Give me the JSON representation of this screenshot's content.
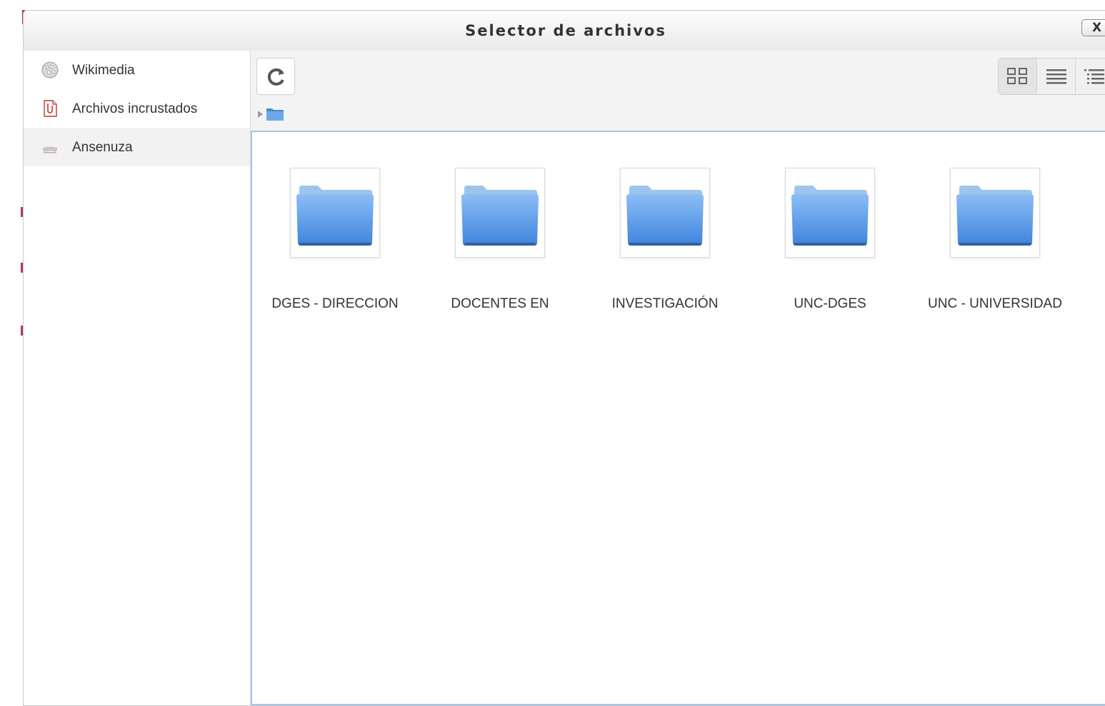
{
  "dialog": {
    "title": "Selector de archivos",
    "close_label": "X"
  },
  "sidebar": {
    "items": [
      {
        "label": "Wikimedia",
        "icon": "wikipedia-globe-icon",
        "active": false
      },
      {
        "label": "Archivos incrustados",
        "icon": "embedded-files-icon",
        "active": false
      },
      {
        "label": "Ansenuza",
        "icon": "repository-icon",
        "active": true
      }
    ]
  },
  "toolbar": {
    "refresh_icon": "refresh-icon",
    "view_modes": [
      "icons-view",
      "list-view",
      "tree-view"
    ],
    "active_view": "icons-view"
  },
  "breadcrumb": {
    "icon": "folder-icon"
  },
  "files": [
    {
      "name": "DGES - DIRECCION",
      "type": "folder"
    },
    {
      "name": "DOCENTES EN",
      "type": "folder"
    },
    {
      "name": "INVESTIGACIÓN",
      "type": "folder"
    },
    {
      "name": "UNC-DGES",
      "type": "folder"
    },
    {
      "name": "UNC - UNIVERSIDAD",
      "type": "folder"
    }
  ],
  "colors": {
    "folder_blue": "#5b9be8",
    "content_border": "#a8c3e6",
    "active_item_bg": "#f2f2f2"
  }
}
